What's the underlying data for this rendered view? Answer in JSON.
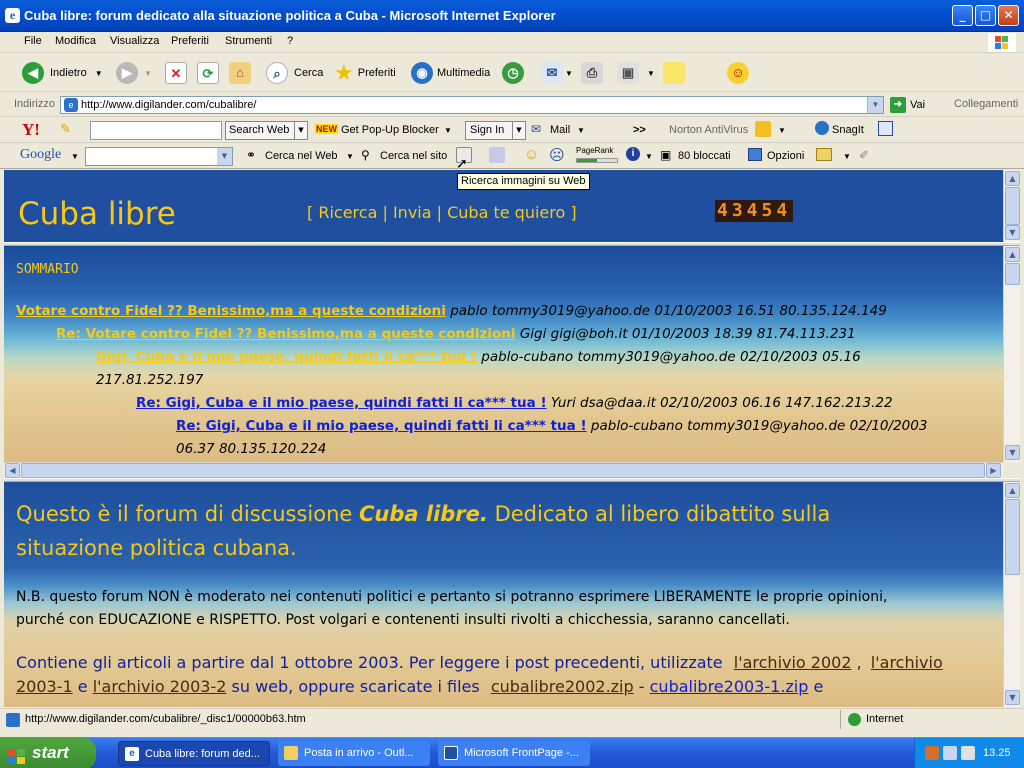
{
  "window": {
    "title": "Cuba libre: forum dedicato alla situazione politica a Cuba - Microsoft Internet Explorer"
  },
  "menu": [
    "File",
    "Modifica",
    "Visualizza",
    "Preferiti",
    "Strumenti",
    "?"
  ],
  "toolbar": {
    "back": "Indietro",
    "search": "Cerca",
    "favorites": "Preferiti",
    "multimedia": "Multimedia"
  },
  "address": {
    "label": "Indirizzo",
    "url": "http://www.digilander.com/cubalibre/",
    "go": "Vai",
    "links": "Collegamenti"
  },
  "yahoo": {
    "search_btn": "Search Web",
    "new_badge": "NEW",
    "popup": "Get Pop-Up Blocker",
    "signin": "Sign In",
    "mail": "Mail",
    "more": ">>",
    "norton": "Norton AntiVirus",
    "snagit": "SnagIt"
  },
  "google": {
    "logo": "Google",
    "web": "Cerca nel Web",
    "site": "Cerca nel sito",
    "pagerank": "PageRank",
    "blocked": "80 bloccati",
    "options": "Opzioni",
    "tooltip": "Ricerca immagini su Web"
  },
  "page": {
    "site_title": "Cuba libre",
    "nav": {
      "open": "[",
      "ricerca": "Ricerca",
      "sep1": "|",
      "invia": "Invia",
      "sep2": "|",
      "cuba": "Cuba te quiero",
      "close": "]"
    },
    "counter": "43454",
    "summary_label": "SOMMARIO",
    "posts": [
      {
        "subject": "Votare contro Fidel ?? Benissimo,ma a queste condizioni",
        "meta": "pablo tommy3019@yahoo.de 01/10/2003 16.51 80.135.124.149"
      },
      {
        "subject": "Re: Votare contro Fidel ?? Benissimo,ma a queste condizioni",
        "meta": "Gigi gigi@boh.it 01/10/2003 18.39 81.74.113.231"
      },
      {
        "subject": "Gigi, Cuba e il mio paese, quindi fatti li ca*** tua !",
        "meta": "pablo-cubano tommy3019@yahoo.de 02/10/2003 05.16",
        "meta2": "217.81.252.197"
      },
      {
        "subject": "Re: Gigi, Cuba e il mio paese, quindi fatti li ca*** tua !",
        "meta": "Yuri dsa@daa.it 02/10/2003 06.16 147.162.213.22"
      },
      {
        "subject": "Re: Gigi, Cuba e il mio paese, quindi fatti li ca*** tua !",
        "meta": "pablo-cubano tommy3019@yahoo.de 02/10/2003",
        "meta2": "06.37 80.135.120.224"
      }
    ],
    "intro_a": "Questo è il forum di discussione",
    "intro_em": "Cuba libre.",
    "intro_b": "Dedicato al libero dibattito sulla",
    "intro_c": "situazione politica cubana.",
    "nb_1": "N.B. questo forum NON è moderato nei contenuti politici e pertanto si potranno esprimere LIBERAMENTE le proprie opinioni,",
    "nb_2": "purché con EDUCAZIONE e RISPETTO. Post volgari e contenenti insulti rivolti a chicchessia, saranno cancellati.",
    "arch_1": "Contiene gli articoli a partire dal 1 ottobre 2003. Per leggere i post precedenti, utilizzate",
    "arch_link1": "l'archivio 2002",
    "arch_comma": ",",
    "arch_link2a": "l'archivio",
    "arch_link2b": "2003-1",
    "arch_e": "e",
    "arch_link3": "l'archivio 2003-2",
    "arch_web": "su web,  oppure scaricate i files",
    "arch_zip1": "cubalibre2002.zip",
    "arch_dash": "-",
    "arch_zip2": "cubalibre2003-1.zip",
    "arch_end": "e"
  },
  "status": {
    "url": "http://www.digilander.com/cubalibre/_disc1/00000b63.htm",
    "zone": "Internet"
  },
  "taskbar": {
    "start": "start",
    "tasks": [
      "Cuba libre: forum ded...",
      "Posta in arrivo - Outl...",
      "Microsoft FrontPage -..."
    ],
    "clock": "13.25"
  },
  "colors": {
    "xp_blue": "#0553d0",
    "page_yellow": "#f6c818",
    "link_blue": "#1020d8",
    "visited": "#4a2a10"
  }
}
